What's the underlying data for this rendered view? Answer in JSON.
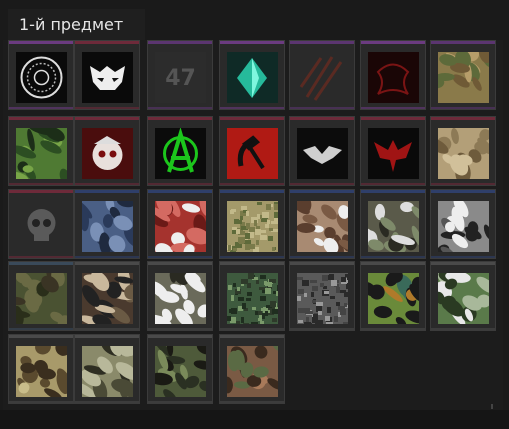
{
  "header": {
    "title": "1-й предмет"
  },
  "rarity_colors": {
    "purple": "#6b3b80",
    "violet": "#5b3570",
    "maroon": "#6e2a3a",
    "blue": "#2f3f6a",
    "gray": "#4a4a4a",
    "steel": "#3a4a5a"
  },
  "items": [
    {
      "name": "round-emblem",
      "rarity": "purple"
    },
    {
      "name": "demon-mask",
      "rarity": "maroon"
    },
    {
      "name": "number-47",
      "rarity": "violet",
      "label": "47"
    },
    {
      "name": "teal-crystal",
      "rarity": "purple"
    },
    {
      "name": "dark-scratch",
      "rarity": "violet"
    },
    {
      "name": "red-dragon",
      "rarity": "purple"
    },
    {
      "name": "desert-camo",
      "rarity": "violet"
    },
    {
      "name": "green-camo",
      "rarity": "maroon"
    },
    {
      "name": "skull-cap",
      "rarity": "maroon"
    },
    {
      "name": "anarchy",
      "rarity": "maroon"
    },
    {
      "name": "hammer-sickle",
      "rarity": "maroon"
    },
    {
      "name": "winged-emblem",
      "rarity": "maroon"
    },
    {
      "name": "red-eagle",
      "rarity": "maroon"
    },
    {
      "name": "tan-camo",
      "rarity": "maroon"
    },
    {
      "name": "skull-patch",
      "rarity": "maroon"
    },
    {
      "name": "blue-camo",
      "rarity": "blue"
    },
    {
      "name": "red-camo",
      "rarity": "blue"
    },
    {
      "name": "pixel-desert",
      "rarity": "blue"
    },
    {
      "name": "brown-camo",
      "rarity": "blue"
    },
    {
      "name": "woodland-camo",
      "rarity": "blue"
    },
    {
      "name": "gray-camo",
      "rarity": "blue"
    },
    {
      "name": "olive-camo",
      "rarity": "steel"
    },
    {
      "name": "dark-woodland",
      "rarity": "gray"
    },
    {
      "name": "snow-woodland",
      "rarity": "gray"
    },
    {
      "name": "green-pixel",
      "rarity": "gray"
    },
    {
      "name": "urban-pixel",
      "rarity": "gray"
    },
    {
      "name": "leopard-camo",
      "rarity": "gray"
    },
    {
      "name": "forest-camo",
      "rarity": "gray"
    },
    {
      "name": "khaki-camo",
      "rarity": "gray"
    },
    {
      "name": "sage-camo",
      "rarity": "gray"
    },
    {
      "name": "moss-camo",
      "rarity": "gray"
    },
    {
      "name": "rust-camo",
      "rarity": "gray"
    }
  ]
}
